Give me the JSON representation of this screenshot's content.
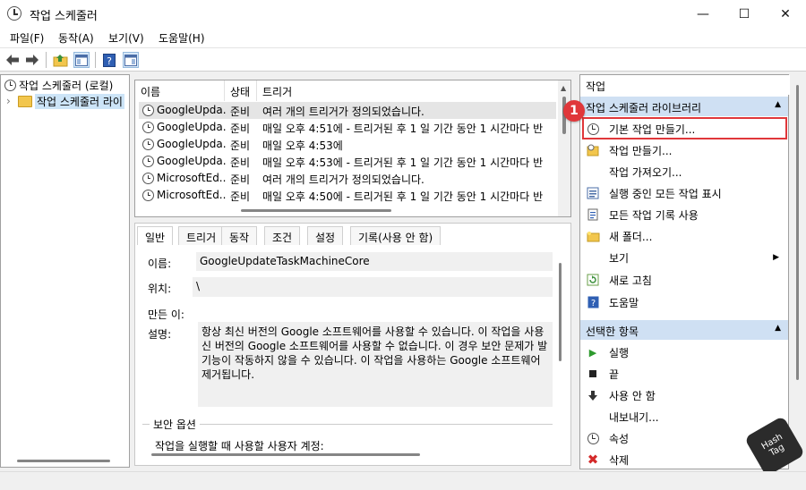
{
  "window": {
    "title": "작업 스케줄러",
    "controls": {
      "minimize": "—",
      "maximize": "☐",
      "close": "✕"
    }
  },
  "menu": [
    {
      "label": "파일(F)"
    },
    {
      "label": "동작(A)"
    },
    {
      "label": "보기(V)"
    },
    {
      "label": "도움말(H)"
    }
  ],
  "toolbar": {
    "icons": [
      "back-arrow-icon",
      "forward-arrow-icon",
      "folder-up-icon",
      "show-hide-console-tree-icon",
      "help-icon",
      "show-hide-action-pane-icon"
    ]
  },
  "tree": {
    "root": "작업 스케줄러 (로컬)",
    "child": "작업 스케줄러 라이",
    "expander": "›"
  },
  "task_list": {
    "columns": [
      "이름",
      "상태",
      "트리거"
    ],
    "rows": [
      {
        "name": "GoogleUpda...",
        "status": "준비",
        "trigger": "여러 개의 트리거가 정의되었습니다."
      },
      {
        "name": "GoogleUpda...",
        "status": "준비",
        "trigger": "매일 오후 4:51에 - 트리거된 후 1 일 기간 동안 1 시간마다 반"
      },
      {
        "name": "GoogleUpda...",
        "status": "준비",
        "trigger": "매일 오후 4:53에"
      },
      {
        "name": "GoogleUpda...",
        "status": "준비",
        "trigger": "매일 오후 4:53에 - 트리거된 후 1 일 기간 동안 1 시간마다 반"
      },
      {
        "name": "MicrosoftEd...",
        "status": "준비",
        "trigger": "여러 개의 트리거가 정의되었습니다."
      },
      {
        "name": "MicrosoftEd...",
        "status": "준비",
        "trigger": "매일 오후 4:50에 - 트리거된 후 1 일 기간 동안 1 시간마다 반"
      }
    ]
  },
  "detail": {
    "tabs": [
      "일반",
      "트리거",
      "동작",
      "조건",
      "설정",
      "기록(사용 안 함)"
    ],
    "name_label": "이름:",
    "name_value": "GoogleUpdateTaskMachineCore",
    "location_label": "위치:",
    "location_value": "\\",
    "author_label": "만든 이:",
    "description_label": "설명:",
    "description_lines": [
      "항상 최신 버전의 Google 소프트웨어를 사용할 수 있습니다. 이 작업을 사용",
      "신 버전의 Google 소프트웨어를 사용할 수 없습니다. 이 경우 보안 문제가 발",
      "기능이 작동하지 않을 수 있습니다. 이 작업을 사용하는 Google 소프트웨어",
      "제거됩니다."
    ],
    "security_group": "보안 옵션",
    "security_text": "작업을 실행할 때 사용할 사용자 계정:"
  },
  "actions": {
    "header": "작업",
    "section1": "작업 스케줄러 라이브러리",
    "section1_items": [
      {
        "label": "기본 작업 만들기...",
        "icon": "clock-wand-icon"
      },
      {
        "label": "작업 만들기...",
        "icon": "task-create-icon"
      },
      {
        "label": "작업 가져오기...",
        "icon": ""
      },
      {
        "label": "실행 중인 모든 작업 표시",
        "icon": "running-tasks-icon"
      },
      {
        "label": "모든 작업 기록 사용",
        "icon": "history-icon"
      },
      {
        "label": "새 폴더...",
        "icon": "new-folder-icon"
      },
      {
        "label": "보기",
        "icon": "",
        "submenu": "▶"
      },
      {
        "label": "새로 고침",
        "icon": "refresh-icon"
      },
      {
        "label": "도움말",
        "icon": "help-icon"
      }
    ],
    "section2": "선택한 항목",
    "section2_items": [
      {
        "label": "실행",
        "icon": "run-icon"
      },
      {
        "label": "끝",
        "icon": "stop-icon"
      },
      {
        "label": "사용 안 함",
        "icon": "disable-icon"
      },
      {
        "label": "내보내기...",
        "icon": ""
      },
      {
        "label": "속성",
        "icon": "properties-icon"
      },
      {
        "label": "삭제",
        "icon": "delete-icon"
      }
    ],
    "collapse_glyph": "▲"
  },
  "annotation": {
    "badge": "1"
  },
  "watermark": {
    "text": "Hash Tag"
  },
  "colors": {
    "accent_selection": "#cce4f7",
    "section_header": "#cfe0f3",
    "highlight_box": "#e0373a",
    "badge": "#e0373a"
  }
}
